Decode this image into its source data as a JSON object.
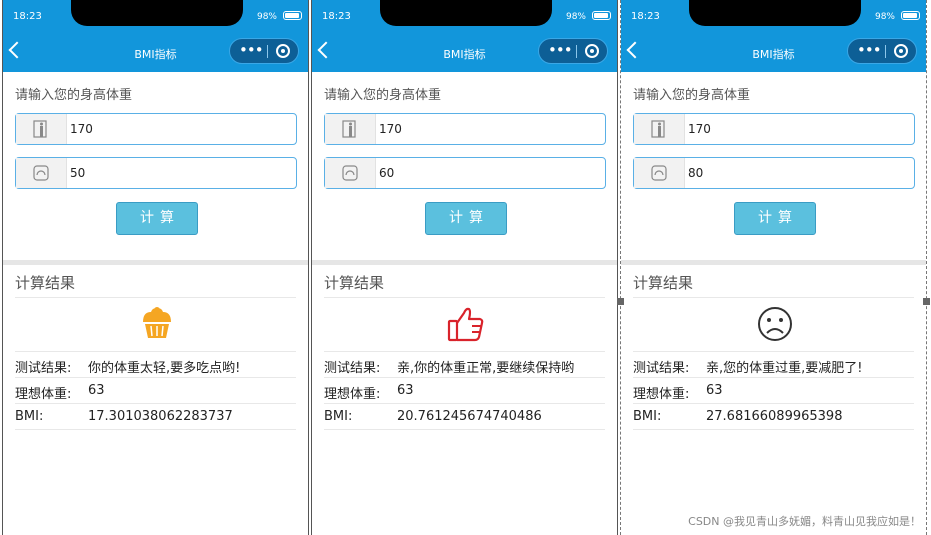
{
  "status_bar": {
    "time": "18:23",
    "battery": "98%"
  },
  "nav": {
    "title": "BMI指标"
  },
  "form": {
    "prompt": "请输入您的身高体重",
    "calc_label": "计算"
  },
  "results": {
    "title": "计算结果",
    "test_label": "测试结果:",
    "ideal_label": "理想体重:",
    "bmi_label": "BMI:"
  },
  "phones": [
    {
      "height": "170",
      "weight": "50",
      "result_text": "你的体重太轻,要多吃点哟!",
      "ideal_weight": "63",
      "bmi": "17.301038062283737",
      "icon": "cupcake-icon",
      "icon_color": "#f5a623"
    },
    {
      "height": "170",
      "weight": "60",
      "result_text": "亲,你的体重正常,要继续保持哟",
      "ideal_weight": "63",
      "bmi": "20.761245674740486",
      "icon": "thumbs-up-icon",
      "icon_color": "#d9232b"
    },
    {
      "height": "170",
      "weight": "80",
      "result_text": "亲,您的体重过重,要减肥了!",
      "ideal_weight": "63",
      "bmi": "27.68166089965398",
      "icon": "sad-face-icon",
      "icon_color": "#333333"
    }
  ],
  "colors": {
    "header": "#1296db",
    "button": "#5bc0de"
  },
  "watermark": "CSDN @我见青山多妩媚，料青山见我应如是！"
}
